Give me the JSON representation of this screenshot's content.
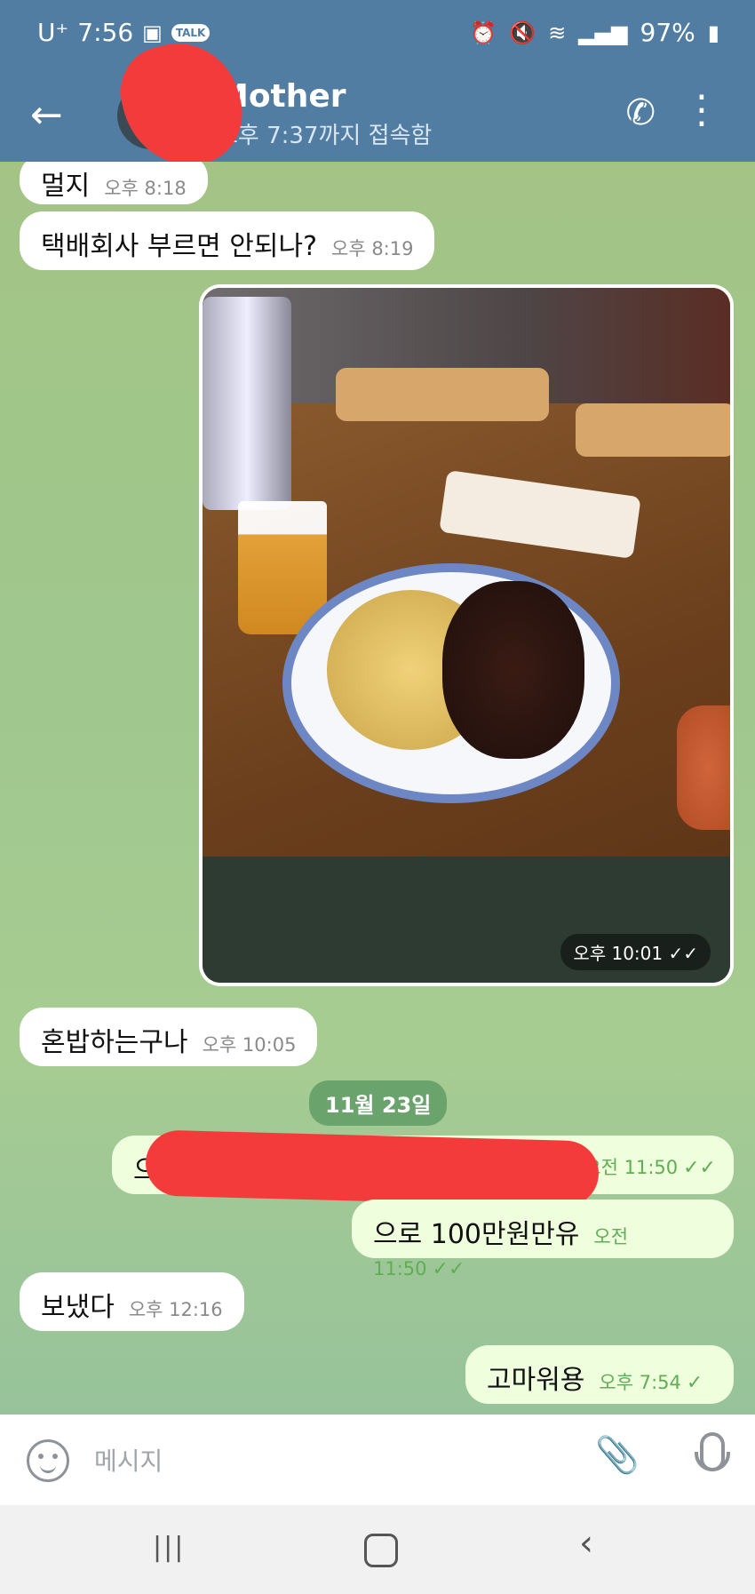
{
  "status_bar": {
    "carrier": "U⁺",
    "clock": "7:56",
    "talk_badge": "TALK",
    "battery": "97%"
  },
  "header": {
    "contact_name": "Mother",
    "last_seen": "오후 7:37까지 접속함"
  },
  "messages": [
    {
      "dir": "in",
      "text": "멀지",
      "time": "오후 8:18"
    },
    {
      "dir": "in",
      "text": "택배회사 부르면 안되나?",
      "time": "오후 8:19"
    },
    {
      "dir": "out",
      "type": "photo",
      "time": "오후 10:01",
      "ticks": "✓✓"
    },
    {
      "dir": "in",
      "text": "혼밥하는구나",
      "time": "오후 10:05"
    },
    {
      "dir": "out",
      "text": "으",
      "time": "오전 11:50",
      "ticks": "✓✓"
    },
    {
      "dir": "out",
      "text": "으로 100만원만유",
      "time": "오전 11:50",
      "ticks": "✓✓"
    },
    {
      "dir": "in",
      "text": "보냈다",
      "time": "오후 12:16"
    },
    {
      "dir": "out",
      "text": "고마워용",
      "time": "오후 7:54",
      "ticks": "✓"
    }
  ],
  "date_separator": "11월 23일",
  "composer": {
    "placeholder": "메시지"
  },
  "icons": {
    "back": "arrow-left",
    "call": "phone",
    "more": "kebab-menu",
    "emoji": "smiley",
    "attach": "paperclip",
    "mic": "microphone"
  },
  "colors": {
    "header": "#517da2",
    "outgoing_bubble": "#effedd",
    "incoming_bubble": "#ffffff",
    "read_tick": "#5fae53"
  }
}
